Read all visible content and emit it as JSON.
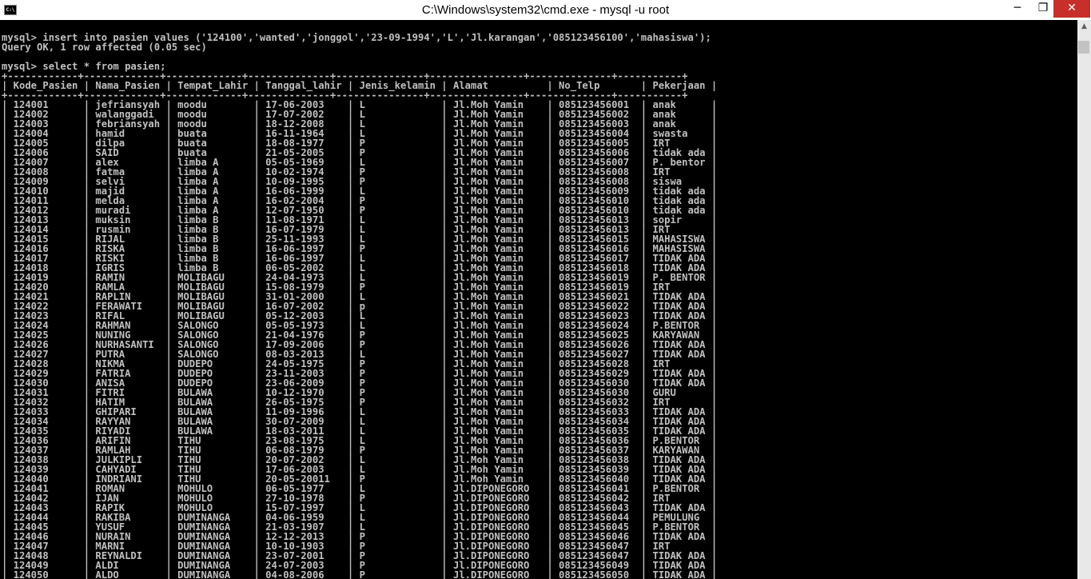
{
  "window": {
    "title": "C:\\Windows\\system32\\cmd.exe - mysql  -u root",
    "icon_label": "C:\\",
    "minimize_glyph": "─",
    "maximize_glyph": "❐",
    "close_glyph": "✕"
  },
  "scrollbar": {
    "up_glyph": "▲"
  },
  "console": {
    "lines": [
      "",
      "mysql> insert into pasien values ('124100','wanted','jonggol','23-09-1994','L','Jl.karangan','085123456100','mahasiswa');",
      "Query OK, 1 row affected (0.05 sec)",
      "",
      "mysql> select * from pasien;",
      "+------------+-------------+-------------+--------------+---------------+----------------+--------------+-----------+",
      "| Kode_Pasien | Nama_Pasien | Tempat_Lahir | Tanggal_lahir | Jenis_kelamin | Alamat          | No_Telp       | Pekerjaan |",
      "+------------+-------------+-------------+--------------+---------------+----------------+--------------+-----------+",
      "| 124001      | jefriansyah | moodu        | 17-06-2003    | L             | Jl.Moh Yamin    | 085123456001  | anak      |",
      "| 124002      | walanggadi  | moodu        | 17-07-2002    | L             | Jl.Moh Yamin    | 085123456002  | anak      |",
      "| 124003      | febriansyah | moodu        | 18-12-2008    | L             | Jl.Moh Yamin    | 085123456003  | anak      |",
      "| 124004      | hamid       | buata        | 16-11-1964    | L             | Jl.Moh Yamin    | 085123456004  | swasta    |",
      "| 124005      | dilpa       | buata        | 18-08-1977    | P             | Jl.Moh Yamin    | 085123456005  | IRT       |",
      "| 124006      | SAID        | buata        | 21-05-2005    | P             | Jl.Moh Yamin    | 085123456006  | tidak ada |",
      "| 124007      | alex        | limba A      | 05-05-1969    | L             | Jl.Moh Yamin    | 085123456007  | P. bentor |",
      "| 124008      | fatma       | limba A      | 10-02-1974    | P             | Jl.Moh Yamin    | 085123456008  | IRT       |",
      "| 124009      | selvi       | limba A      | 10-09-1995    | P             | Jl.Moh Yamin    | 085123456008  | siswa     |",
      "| 124010      | majid       | limba A      | 16-06-1999    | L             | Jl.Moh Yamin    | 085123456009  | tidak ada |",
      "| 124011      | melda       | limba A      | 16-02-2004    | P             | Jl.Moh Yamin    | 085123456010  | tidak ada |",
      "| 124012      | muradi      | limba A      | 12-07-1950    | P             | Jl.Moh Yamin    | 085123456010  | tidak ada |",
      "| 124013      | muksin      | limba B      | 11-08-1971    | L             | Jl.Moh Yamin    | 085123456013  | sopir     |",
      "| 124014      | rusmin      | limba B      | 16-07-1979    | L             | Jl.Moh Yamin    | 085123456013  | IRT       |",
      "| 124015      | RIJAL       | limba B      | 25-11-1993    | L             | Jl.Moh Yamin    | 085123456015  | MAHASISWA |",
      "| 124016      | RISKA       | limba B      | 16-06-1997    | P             | Jl.Moh Yamin    | 085123456016  | MAHASISWA |",
      "| 124017      | RISKI       | limba B      | 16-06-1997    | L             | Jl.Moh Yamin    | 085123456017  | TIDAK ADA |",
      "| 124018      | IGRIS       | limba B      | 06-05-2002    | L             | Jl.Moh Yamin    | 085123456018  | TIDAK ADA |",
      "| 124019      | RAMIN       | MOLIBAGU     | 24-04-1973    | L             | Jl.Moh Yamin    | 085123456019  | P. BENTOR |",
      "| 124020      | RAMLA       | MOLIBAGU     | 15-08-1979    | P             | Jl.Moh Yamin    | 085123456019  | IRT       |",
      "| 124021      | RAPLIN      | MOLIBAGU     | 31-01-2000    | L             | Jl.Moh Yamin    | 085123456021  | TIDAK ADA |",
      "| 124022      | FERAWATI    | MOLIBAGU     | 16-07-2002    | p             | Jl.Moh Yamin    | 085123456022  | TIDAK ADA |",
      "| 124023      | RIFAL       | MOLIBAGU     | 05-12-2003    | L             | Jl.Moh Yamin    | 085123456023  | TIDAK ADA |",
      "| 124024      | RAHMAN      | SALONGO      | 05-05-1973    | L             | Jl.Moh Yamin    | 085123456024  | P.BENTOR  |",
      "| 124025      | NUNING      | SALONGO      | 21-04-1976    | P             | Jl.Moh Yamin    | 085123456025  | KARYAWAN  |",
      "| 124026      | NURHASANTI  | SALONGO      | 17-09-2006    | P             | Jl.Moh Yamin    | 085123456026  | TIDAK ADA |",
      "| 124027      | PUTRA       | SALONGO      | 08-03-2013    | L             | Jl.Moh Yamin    | 085123456027  | TIDAK ADA |",
      "| 124028      | NIKMA       | DUDEPO       | 24-05-1975    | P             | Jl.Moh Yamin    | 085123456028  | IRT       |",
      "| 124029      | FATRIA      | DUDEPO       | 23-11-2003    | P             | Jl.Moh Yamin    | 085123456029  | TIDAK ADA |",
      "| 124030      | ANISA       | DUDEPO       | 23-06-2009    | P             | Jl.Moh Yamin    | 085123456030  | TIDAK ADA |",
      "| 124031      | FITRI       | BULAWA       | 10-12-1970    | P             | Jl.Moh Yamin    | 085123456030  | GURU      |",
      "| 124032      | HATIM       | BULAWA       | 26-05-1975    | P             | Jl.Moh Yamin    | 085123456032  | IRT       |",
      "| 124033      | GHIPARI     | BULAWA       | 11-09-1996    | L             | Jl.Moh Yamin    | 085123456033  | TIDAK ADA |",
      "| 124034      | RAYYAN      | BULAWA       | 30-07-2009    | L             | Jl.Moh Yamin    | 085123456034  | TIDAK ADA |",
      "| 124035      | RIYADI      | BULAWA       | 18-03-2011    | L             | Jl.Moh Yamin    | 085123456035  | TIDAK ADA |",
      "| 124036      | ARIFIN      | TIHU         | 23-08-1975    | L             | Jl.Moh Yamin    | 085123456036  | P.BENTOR  |",
      "| 124037      | RAMLAH      | TIHU         | 06-08-1979    | P             | Jl.Moh Yamin    | 085123456037  | KARYAWAN  |",
      "| 124038      | JULKIPLI    | TIHU         | 20-07-2002    | L             | Jl.Moh Yamin    | 085123456038  | TIDAK ADA |",
      "| 124039      | CAHYADI     | TIHU         | 17-06-2003    | L             | Jl.Moh Yamin    | 085123456039  | TIDAK ADA |",
      "| 124040      | INDRIANI    | TIHU         | 20-05-20011   | P             | Jl.Moh Yamin    | 085123456040  | TIDAK ADA |",
      "| 124041      | ROMAN       | MOHULO       | 06-05-1977    | L             | Jl.DIPONEGORO   | 085123456041  | P.BENTOR  |",
      "| 124042      | IJAN        | MOHULO       | 27-10-1978    | P             | Jl.DIPONEGORO   | 085123456042  | IRT       |",
      "| 124043      | RAPIK       | MOHULO       | 15-07-1997    | L             | Jl.DIPONEGORO   | 085123456043  | TIDAK ADA |",
      "| 124044      | RAKIBA      | DUMINANGA    | 04-06-1959    | L             | Jl.DIPONEGORO   | 085123456044  | PEMULUNG  |",
      "| 124045      | YUSUF       | DUMINANGA    | 21-03-1907    | L             | Jl.DIPONEGORO   | 085123456045  | P.BENTOR  |",
      "| 124046      | NURAIN      | DUMINANGA    | 12-12-2013    | P             | Jl.DIPONEGORO   | 085123456046  | TIDAK ADA |",
      "| 124047      | MARNI       | DUMINANGA    | 10-10-1903    | P             | Jl.DIPONEGORO   | 085123456047  | IRT       |",
      "| 124048      | REYNALDI    | DUMINANGA    | 23-07-2001    | P             | Jl.DIPONEGORO   | 085123456047  | TIDAK ADA |",
      "| 124049      | ALDI        | DUMINANGA    | 24-07-2003    | P             | Jl.DIPONEGORO   | 085123456049  | TIDAK ADA |",
      "| 124050      | ALDO        | DUMINANGA    | 04-08-2006    | P             | Jl.DIPONEGORO   | 085123456050  | TIDAK ADA |"
    ]
  }
}
